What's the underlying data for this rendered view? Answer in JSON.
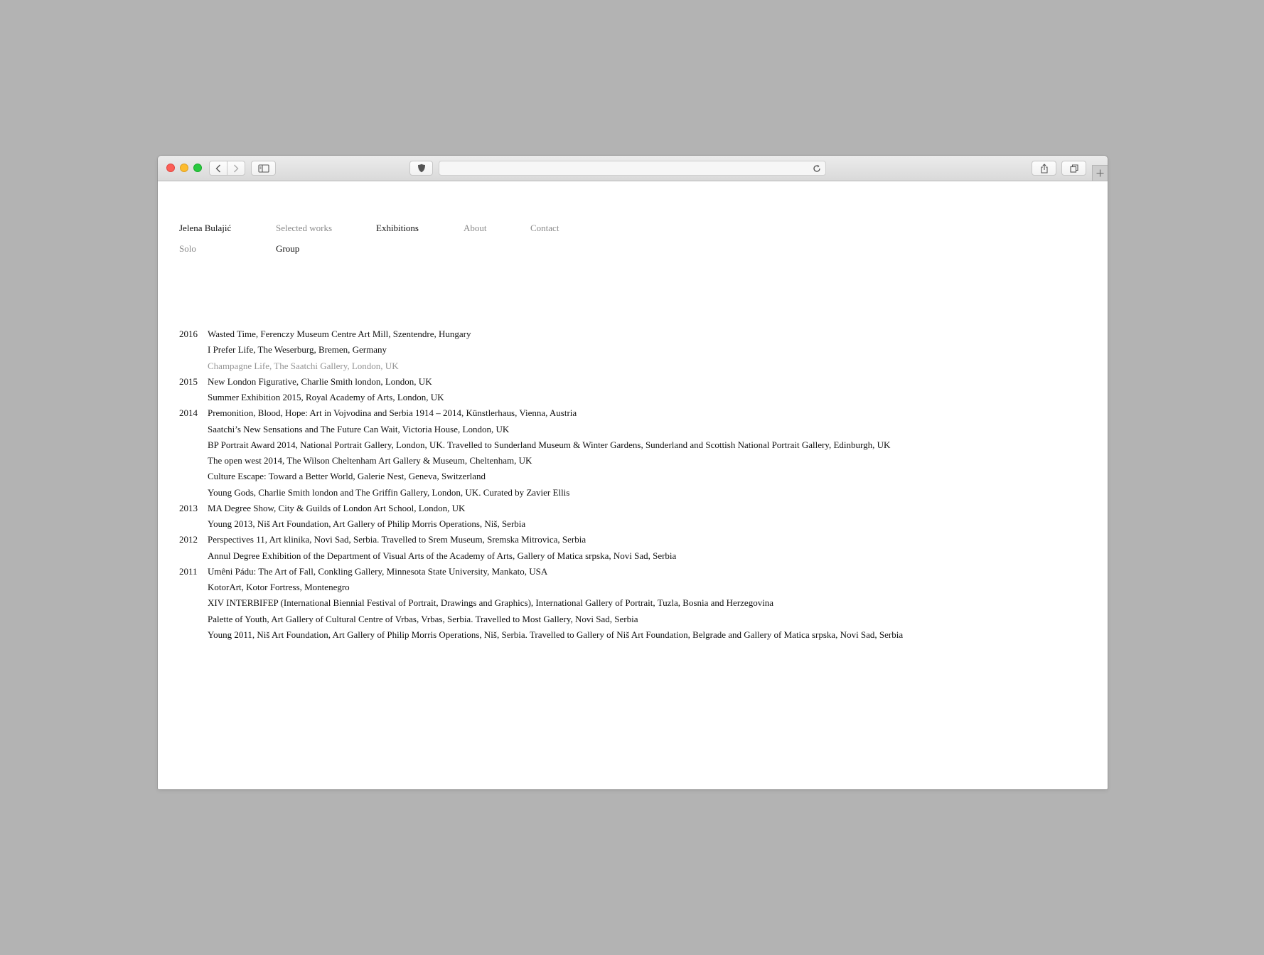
{
  "site": {
    "name": "Jelena Bulajić"
  },
  "nav": [
    {
      "label": "Selected works",
      "active": false
    },
    {
      "label": "Exhibitions",
      "active": true
    },
    {
      "label": "About",
      "active": false
    },
    {
      "label": "Contact",
      "active": false
    }
  ],
  "subnav": [
    {
      "label": "Solo",
      "active": false
    },
    {
      "label": "Group",
      "active": true
    }
  ],
  "browser": {
    "icons": [
      "back-icon",
      "forward-icon",
      "sidebar-icon",
      "privacy-icon",
      "reload-icon",
      "share-icon",
      "tabs-icon",
      "new-tab-icon"
    ]
  },
  "exhibitions": [
    {
      "year": "2016",
      "title": "Wasted Time, Ferenczy Museum Centre Art Mill, Szentendre, Hungary"
    },
    {
      "year": "",
      "title": "I Prefer Life, The Weserburg, Bremen, Germany"
    },
    {
      "year": "",
      "title": "Champagne Life, The Saatchi Gallery, London, UK",
      "muted": true
    },
    {
      "year": "2015",
      "title": "New London Figurative, Charlie Smith london, London, UK"
    },
    {
      "year": "",
      "title": "Summer Exhibition 2015, Royal Academy of Arts, London, UK"
    },
    {
      "year": "2014",
      "title": "Premonition, Blood, Hope: Art in Vojvodina and Serbia 1914 – 2014, Künstlerhaus, Vienna, Austria"
    },
    {
      "year": "",
      "title": "Saatchi’s New Sensations and The Future Can Wait, Victoria House, London, UK"
    },
    {
      "year": "",
      "title": "BP Portrait Award 2014, National Portrait Gallery, London, UK. Travelled to Sunderland Museum & Winter Gardens, Sunderland and Scottish National Portrait Gallery, Edinburgh, UK"
    },
    {
      "year": "",
      "title": "The open west 2014, The Wilson Cheltenham Art Gallery & Museum, Cheltenham, UK"
    },
    {
      "year": "",
      "title": "Culture Escape: Toward a Better World, Galerie Nest, Geneva, Switzerland"
    },
    {
      "year": "",
      "title": "Young Gods, Charlie Smith london and The Griffin Gallery, London, UK. Curated by Zavier Ellis"
    },
    {
      "year": "2013",
      "title": "MA Degree Show, City & Guilds of London Art School, London, UK"
    },
    {
      "year": "",
      "title": "Young 2013, Niš Art Foundation, Art Gallery of Philip Morris Operations, Niš, Serbia"
    },
    {
      "year": "2012",
      "title": "Perspectives 11, Art klinika, Novi Sad, Serbia. Travelled to Srem Museum, Sremska Mitrovica, Serbia"
    },
    {
      "year": "",
      "title": "Annul Degree Exhibition of the Department of Visual Arts of the Academy of Arts, Gallery of Matica srpska, Novi Sad, Serbia"
    },
    {
      "year": "2011",
      "title": "Umêni Pádu: The Art of Fall, Conkling Gallery, Minnesota State University, Mankato, USA"
    },
    {
      "year": "",
      "title": "KotorArt, Kotor Fortress, Montenegro"
    },
    {
      "year": "",
      "title": "XIV INTERBIFEP (International Biennial Festival of Portrait, Drawings and Graphics), International Gallery of Portrait, Tuzla, Bosnia and Herzegovina"
    },
    {
      "year": "",
      "title": "Palette of Youth, Art Gallery of Cultural Centre of Vrbas, Vrbas, Serbia. Travelled to Most Gallery, Novi Sad, Serbia"
    },
    {
      "year": "",
      "title": "Young 2011, Niš Art Foundation, Art Gallery of Philip Morris Operations, Niš, Serbia. Travelled to Gallery of Niš Art Foundation, Belgrade and Gallery of Matica srpska, Novi Sad, Serbia"
    }
  ]
}
